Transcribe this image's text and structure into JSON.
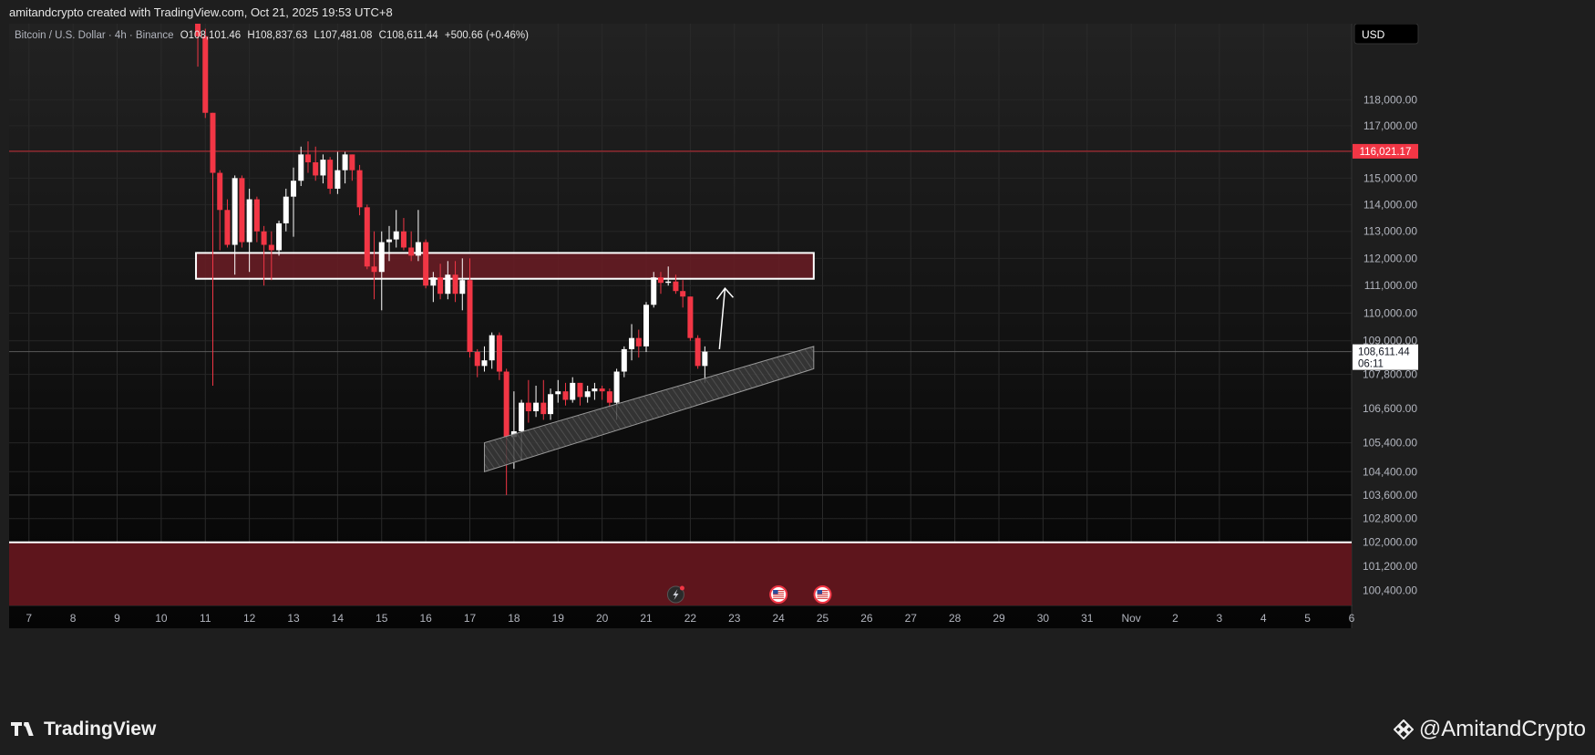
{
  "header": {
    "attribution": "amitandcrypto created with TradingView.com, Oct 21, 2025 19:53 UTC+8"
  },
  "legend": {
    "symbol": "Bitcoin / U.S. Dollar · 4h · Binance",
    "open": "O108,101.46",
    "high": "H108,837.63",
    "low": "L107,481.08",
    "close": "C108,611.44",
    "change": "+500.66 (+0.46%)"
  },
  "currency": "USD",
  "price_label": {
    "value": "108,611.44",
    "countdown": "06:11"
  },
  "level_label": {
    "value": "116,021.17"
  },
  "footer": {
    "brand": "TradingView",
    "handle": "@AmitandCrypto"
  },
  "colors": {
    "up": "#ffffff",
    "down": "#f23645",
    "zone": "#7a1a22",
    "background": "#121212"
  },
  "chart_data": {
    "type": "candlestick",
    "timeframe": "4h",
    "y_scale": "log",
    "ylim": [
      99900,
      121000
    ],
    "y_ticks": [
      118000,
      117000,
      116000,
      115000,
      114000,
      113000,
      112000,
      111000,
      110000,
      109000,
      107800,
      106600,
      105400,
      104400,
      103600,
      102800,
      102000,
      101200,
      100400
    ],
    "y_tick_labels": [
      "118,000.00",
      "117,000.00",
      "",
      "115,000.00",
      "114,000.00",
      "113,000.00",
      "112,000.00",
      "111,000.00",
      "110,000.00",
      "109,000.00",
      "107,800.00",
      "106,600.00",
      "105,400.00",
      "104,400.00",
      "103,600.00",
      "102,800.00",
      "102,000.00",
      "101,200.00",
      "100,400.00"
    ],
    "x_ticks": [
      7,
      8,
      9,
      10,
      11,
      12,
      13,
      14,
      15,
      16,
      17,
      18,
      19,
      20,
      21,
      22,
      23,
      24,
      25,
      26,
      27,
      28,
      29,
      30,
      31,
      32,
      33,
      34,
      35,
      36,
      37
    ],
    "x_tick_labels": [
      "7",
      "8",
      "9",
      "10",
      "11",
      "12",
      "13",
      "14",
      "15",
      "16",
      "17",
      "18",
      "19",
      "20",
      "21",
      "22",
      "23",
      "24",
      "25",
      "26",
      "27",
      "28",
      "29",
      "30",
      "31",
      "Nov",
      "2",
      "3",
      "4",
      "5",
      "6"
    ],
    "x_range": [
      6.55,
      37.0
    ],
    "candles": [
      {
        "x": 10.83,
        "o": 121000,
        "h": 121000,
        "l": 119300,
        "c": 120500
      },
      {
        "x": 11.0,
        "o": 120500,
        "h": 120800,
        "l": 117300,
        "c": 117500
      },
      {
        "x": 11.17,
        "o": 117500,
        "h": 117500,
        "l": 107400,
        "c": 115200
      },
      {
        "x": 11.33,
        "o": 115200,
        "h": 115300,
        "l": 112300,
        "c": 113800
      },
      {
        "x": 11.5,
        "o": 113800,
        "h": 114200,
        "l": 112400,
        "c": 112500
      },
      {
        "x": 11.67,
        "o": 112500,
        "h": 115100,
        "l": 111400,
        "c": 115000
      },
      {
        "x": 11.83,
        "o": 115000,
        "h": 115100,
        "l": 112400,
        "c": 112600
      },
      {
        "x": 12.0,
        "o": 112600,
        "h": 114600,
        "l": 111500,
        "c": 114200
      },
      {
        "x": 12.17,
        "o": 114200,
        "h": 114300,
        "l": 112600,
        "c": 113000
      },
      {
        "x": 12.33,
        "o": 113000,
        "h": 113200,
        "l": 111000,
        "c": 112500
      },
      {
        "x": 12.5,
        "o": 112500,
        "h": 113000,
        "l": 111200,
        "c": 112300
      },
      {
        "x": 12.67,
        "o": 112300,
        "h": 113400,
        "l": 112100,
        "c": 113300
      },
      {
        "x": 12.83,
        "o": 113300,
        "h": 114600,
        "l": 113000,
        "c": 114300
      },
      {
        "x": 13.0,
        "o": 114300,
        "h": 115400,
        "l": 112800,
        "c": 114900
      },
      {
        "x": 13.17,
        "o": 114900,
        "h": 116200,
        "l": 114700,
        "c": 115900
      },
      {
        "x": 13.33,
        "o": 115900,
        "h": 116400,
        "l": 115200,
        "c": 115600
      },
      {
        "x": 13.5,
        "o": 115600,
        "h": 116200,
        "l": 114900,
        "c": 115100
      },
      {
        "x": 13.67,
        "o": 115100,
        "h": 115900,
        "l": 114800,
        "c": 115700
      },
      {
        "x": 13.83,
        "o": 115700,
        "h": 115800,
        "l": 114400,
        "c": 114600
      },
      {
        "x": 14.0,
        "o": 114600,
        "h": 116000,
        "l": 114400,
        "c": 115300
      },
      {
        "x": 14.17,
        "o": 115300,
        "h": 116000,
        "l": 114800,
        "c": 115900
      },
      {
        "x": 14.33,
        "o": 115900,
        "h": 115900,
        "l": 114900,
        "c": 115300
      },
      {
        "x": 14.5,
        "o": 115300,
        "h": 115500,
        "l": 113600,
        "c": 113900
      },
      {
        "x": 14.67,
        "o": 113900,
        "h": 114000,
        "l": 111600,
        "c": 111700
      },
      {
        "x": 14.83,
        "o": 111700,
        "h": 113000,
        "l": 110500,
        "c": 111500
      },
      {
        "x": 15.0,
        "o": 111500,
        "h": 113000,
        "l": 110100,
        "c": 112600
      },
      {
        "x": 15.17,
        "o": 112600,
        "h": 113200,
        "l": 111900,
        "c": 112700
      },
      {
        "x": 15.33,
        "o": 112700,
        "h": 113800,
        "l": 112400,
        "c": 113000
      },
      {
        "x": 15.5,
        "o": 113000,
        "h": 113500,
        "l": 112300,
        "c": 112400
      },
      {
        "x": 15.67,
        "o": 112400,
        "h": 113000,
        "l": 111900,
        "c": 112100
      },
      {
        "x": 15.83,
        "o": 112100,
        "h": 113800,
        "l": 111900,
        "c": 112600
      },
      {
        "x": 16.0,
        "o": 112600,
        "h": 112700,
        "l": 110900,
        "c": 111000
      },
      {
        "x": 16.17,
        "o": 111000,
        "h": 111500,
        "l": 110400,
        "c": 111300
      },
      {
        "x": 16.33,
        "o": 111300,
        "h": 111800,
        "l": 110500,
        "c": 110700
      },
      {
        "x": 16.5,
        "o": 110700,
        "h": 111900,
        "l": 110500,
        "c": 111400
      },
      {
        "x": 16.67,
        "o": 111400,
        "h": 111900,
        "l": 110400,
        "c": 110700
      },
      {
        "x": 16.83,
        "o": 110700,
        "h": 112000,
        "l": 110100,
        "c": 111200
      },
      {
        "x": 17.0,
        "o": 111200,
        "h": 112000,
        "l": 108400,
        "c": 108600
      },
      {
        "x": 17.17,
        "o": 108600,
        "h": 108700,
        "l": 107700,
        "c": 108100
      },
      {
        "x": 17.33,
        "o": 108100,
        "h": 108800,
        "l": 107900,
        "c": 108300
      },
      {
        "x": 17.5,
        "o": 108300,
        "h": 109300,
        "l": 108000,
        "c": 109200
      },
      {
        "x": 17.67,
        "o": 109200,
        "h": 109300,
        "l": 107600,
        "c": 107900
      },
      {
        "x": 17.83,
        "o": 107900,
        "h": 108000,
        "l": 103600,
        "c": 105600
      },
      {
        "x": 18.0,
        "o": 105600,
        "h": 107200,
        "l": 104500,
        "c": 105800
      },
      {
        "x": 18.17,
        "o": 105800,
        "h": 106900,
        "l": 104800,
        "c": 106800
      },
      {
        "x": 18.33,
        "o": 106800,
        "h": 107600,
        "l": 106100,
        "c": 106500
      },
      {
        "x": 18.5,
        "o": 106500,
        "h": 107400,
        "l": 106300,
        "c": 106800
      },
      {
        "x": 18.67,
        "o": 106800,
        "h": 107600,
        "l": 106200,
        "c": 106400
      },
      {
        "x": 18.83,
        "o": 106400,
        "h": 107300,
        "l": 106200,
        "c": 107100
      },
      {
        "x": 19.0,
        "o": 107100,
        "h": 107600,
        "l": 106800,
        "c": 107200
      },
      {
        "x": 19.17,
        "o": 107200,
        "h": 107500,
        "l": 106700,
        "c": 106900
      },
      {
        "x": 19.33,
        "o": 106900,
        "h": 107700,
        "l": 106800,
        "c": 107500
      },
      {
        "x": 19.5,
        "o": 107500,
        "h": 107500,
        "l": 106700,
        "c": 107000
      },
      {
        "x": 19.67,
        "o": 107000,
        "h": 107400,
        "l": 106800,
        "c": 107200
      },
      {
        "x": 19.83,
        "o": 107200,
        "h": 107500,
        "l": 106900,
        "c": 107300
      },
      {
        "x": 20.0,
        "o": 107300,
        "h": 107400,
        "l": 106900,
        "c": 107200
      },
      {
        "x": 20.17,
        "o": 107200,
        "h": 107300,
        "l": 106600,
        "c": 106800
      },
      {
        "x": 20.33,
        "o": 106800,
        "h": 108000,
        "l": 106200,
        "c": 107900
      },
      {
        "x": 20.5,
        "o": 107900,
        "h": 108800,
        "l": 107700,
        "c": 108700
      },
      {
        "x": 20.67,
        "o": 108700,
        "h": 109600,
        "l": 108300,
        "c": 109100
      },
      {
        "x": 20.83,
        "o": 109100,
        "h": 109400,
        "l": 108400,
        "c": 108800
      },
      {
        "x": 21.0,
        "o": 108800,
        "h": 110400,
        "l": 108600,
        "c": 110300
      },
      {
        "x": 21.17,
        "o": 110300,
        "h": 111500,
        "l": 110200,
        "c": 111300
      },
      {
        "x": 21.33,
        "o": 111300,
        "h": 111500,
        "l": 110700,
        "c": 111100
      },
      {
        "x": 21.5,
        "o": 111100,
        "h": 111700,
        "l": 111000,
        "c": 111150
      },
      {
        "x": 21.67,
        "o": 111150,
        "h": 111400,
        "l": 110700,
        "c": 110800
      },
      {
        "x": 21.83,
        "o": 110800,
        "h": 111200,
        "l": 110200,
        "c": 110600
      },
      {
        "x": 22.0,
        "o": 110600,
        "h": 110600,
        "l": 109000,
        "c": 109100
      },
      {
        "x": 22.17,
        "o": 109100,
        "h": 109200,
        "l": 108000,
        "c": 108100
      },
      {
        "x": 22.33,
        "o": 108100,
        "h": 108800,
        "l": 107500,
        "c": 108611
      }
    ],
    "annotations": {
      "resistance_zone": {
        "x_from": 10.83,
        "x_to": 24.8,
        "y_from": 111250,
        "y_to": 112200
      },
      "support_zone": {
        "x_from": 6.55,
        "x_to": 37.0,
        "y_from": 99900,
        "y_to": 102000
      },
      "rising_channel": {
        "x_from": 17.33,
        "x_to": 24.8,
        "upper_from": 105400,
        "upper_to": 108800,
        "lower_from": 104400,
        "lower_to": 108000
      },
      "arrow": {
        "x_from": 22.33,
        "y_from": 108700,
        "x_to": 22.58,
        "y_to": 110900
      },
      "resistance_level": 116021.17,
      "current_price": 108611.44
    },
    "event_markers": [
      {
        "x": 21.67,
        "type": "lightning"
      },
      {
        "x": 24.0,
        "type": "us-flag"
      },
      {
        "x": 25.0,
        "type": "us-flag"
      }
    ]
  }
}
